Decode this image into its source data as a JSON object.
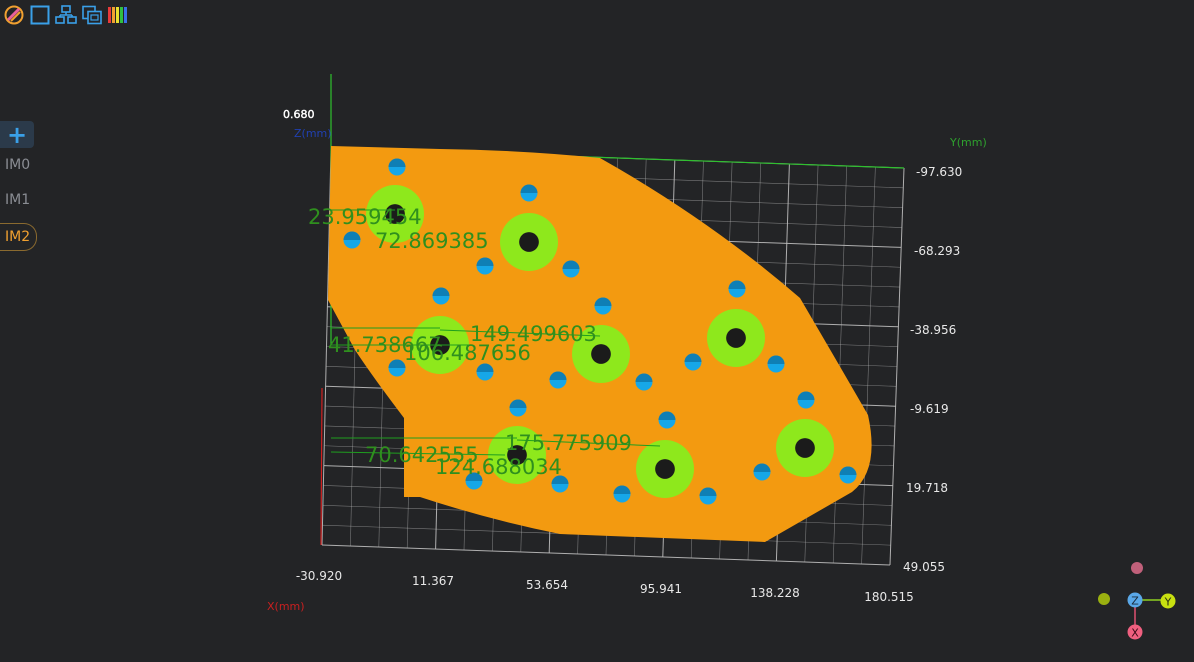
{
  "toolbar": {
    "buttons": [
      {
        "name": "palette-icon"
      },
      {
        "name": "square-select-icon"
      },
      {
        "name": "align-icon"
      },
      {
        "name": "copy-icon"
      },
      {
        "name": "color-bar-icon"
      }
    ]
  },
  "sidebar": {
    "add_label": "+",
    "items": [
      {
        "label": "IM0",
        "active": false
      },
      {
        "label": "IM1",
        "active": false
      },
      {
        "label": "IM2",
        "active": true
      }
    ]
  },
  "viewer": {
    "corner_label": "0.680",
    "axis_labels": {
      "x": "X(mm)",
      "y": "Y(mm)",
      "z": "Z(mm)"
    },
    "x_ticks": [
      "-30.920",
      "11.367",
      "53.654",
      "95.941",
      "138.228",
      "180.515"
    ],
    "y_ticks": [
      "-97.630",
      "-68.293",
      "-38.956",
      "-9.619",
      "19.718",
      "49.055"
    ],
    "measurements": [
      "23.959454",
      "72.869385",
      "41.738667",
      "149.499603",
      "106.487656",
      "175.775909",
      "70.642555",
      "124.688034"
    ]
  },
  "gizmo": {
    "z": "Z",
    "y": "Y",
    "x": "X"
  },
  "colors": {
    "background": "#232426",
    "accent": "#f0a030",
    "part_fill": "#f39a10",
    "hole": "#16a7e8",
    "boss": "#8ee81c",
    "measure_text": "#2f8f1e"
  }
}
